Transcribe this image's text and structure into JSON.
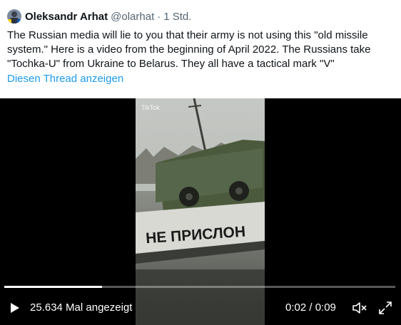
{
  "tweet": {
    "author_name": "Oleksandr Arhat",
    "handle": "@olarhat",
    "separator": "·",
    "time": "1 Std.",
    "text_lines": [
      "The Russian media will lie to you that their army is not using this \"old missile",
      "system.\" Here is a video from the beginning of April 2022. The Russians take",
      "\"Tochka-U\" from Ukraine to Belarus. They all have a tactical mark \"V\""
    ],
    "show_thread": "Diesen Thread anzeigen"
  },
  "video": {
    "overlay_sign_text": "НЕ ПРИСЛОН",
    "watermark": "TikTok",
    "views": "25.634 Mal angezeigt",
    "timecode": "0:02 / 0:09",
    "progress": 0.25
  },
  "colors": {
    "link": "#1d9bf0",
    "text": "#0f1419",
    "muted": "#536471"
  },
  "icons": {
    "play": "play-icon",
    "mute": "mute-icon",
    "fullscreen": "fullscreen-icon",
    "avatar": "avatar"
  }
}
